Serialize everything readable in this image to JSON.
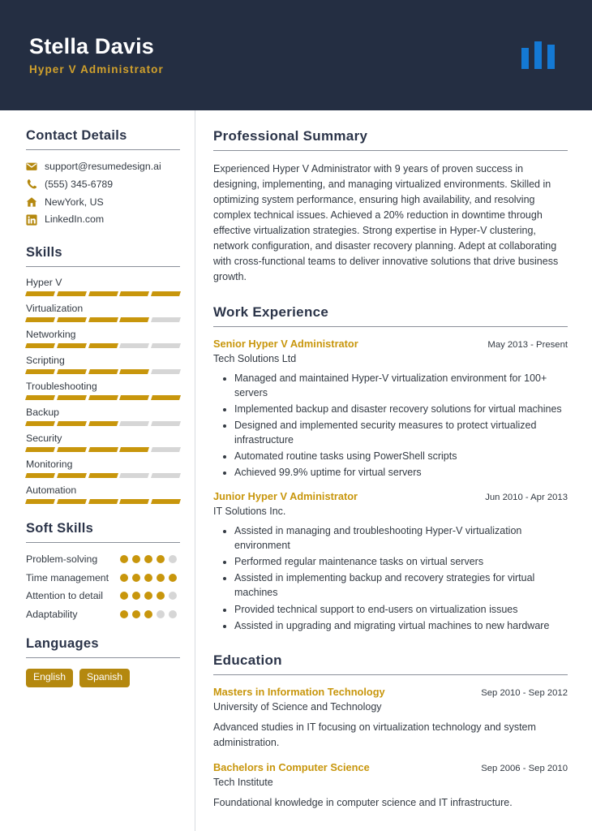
{
  "header": {
    "full_name": "Stella Davis",
    "job_title": "Hyper V Administrator",
    "logo_icon": "three-bars-logo-icon",
    "background_color": "#242e42",
    "accent_color": "#d1a12c",
    "logo_color": "#1479d4"
  },
  "sidebar": {
    "contact": {
      "heading": "Contact Details",
      "items": [
        {
          "icon": "envelope-icon",
          "text": "support@resumedesign.ai"
        },
        {
          "icon": "phone-icon",
          "text": "(555) 345-6789"
        },
        {
          "icon": "home-icon",
          "text": "NewYork, US"
        },
        {
          "icon": "linkedin-icon",
          "text": "LinkedIn.com"
        }
      ]
    },
    "skills": {
      "heading": "Skills",
      "segments_total": 5,
      "items": [
        {
          "name": "Hyper V",
          "filled": 5
        },
        {
          "name": "Virtualization",
          "filled": 4
        },
        {
          "name": "Networking",
          "filled": 3
        },
        {
          "name": "Scripting",
          "filled": 4
        },
        {
          "name": "Troubleshooting",
          "filled": 5
        },
        {
          "name": "Backup",
          "filled": 3
        },
        {
          "name": "Security",
          "filled": 4
        },
        {
          "name": "Monitoring",
          "filled": 3
        },
        {
          "name": "Automation",
          "filled": 5
        }
      ]
    },
    "soft_skills": {
      "heading": "Soft Skills",
      "dots_total": 5,
      "items": [
        {
          "name": "Problem-solving",
          "filled": 4
        },
        {
          "name": "Time management",
          "filled": 5
        },
        {
          "name": "Attention to detail",
          "filled": 4
        },
        {
          "name": "Adaptability",
          "filled": 3
        }
      ]
    },
    "languages": {
      "heading": "Languages",
      "items": [
        "English",
        "Spanish"
      ]
    }
  },
  "main": {
    "summary": {
      "heading": "Professional Summary",
      "text": "Experienced Hyper V Administrator with 9 years of proven success in designing, implementing, and managing virtualized environments. Skilled in optimizing system performance, ensuring high availability, and resolving complex technical issues. Achieved a 20% reduction in downtime through effective virtualization strategies. Strong expertise in Hyper-V clustering, network configuration, and disaster recovery planning. Adept at collaborating with cross-functional teams to deliver innovative solutions that drive business growth."
    },
    "experience": {
      "heading": "Work Experience",
      "entries": [
        {
          "role": "Senior Hyper V Administrator",
          "date": "May 2013 - Present",
          "organization": "Tech Solutions Ltd",
          "bullets": [
            "Managed and maintained Hyper-V virtualization environment for 100+ servers",
            "Implemented backup and disaster recovery solutions for virtual machines",
            "Designed and implemented security measures to protect virtualized infrastructure",
            "Automated routine tasks using PowerShell scripts",
            "Achieved 99.9% uptime for virtual servers"
          ]
        },
        {
          "role": "Junior Hyper V Administrator",
          "date": "Jun 2010 - Apr 2013",
          "organization": "IT Solutions Inc.",
          "bullets": [
            "Assisted in managing and troubleshooting Hyper-V virtualization environment",
            "Performed regular maintenance tasks on virtual servers",
            "Assisted in implementing backup and recovery strategies for virtual machines",
            "Provided technical support to end-users on virtualization issues",
            "Assisted in upgrading and migrating virtual machines to new hardware"
          ]
        }
      ]
    },
    "education": {
      "heading": "Education",
      "entries": [
        {
          "degree": "Masters in Information Technology",
          "date": "Sep 2010 - Sep 2012",
          "institution": "University of Science and Technology",
          "description": "Advanced studies in IT focusing on virtualization technology and system administration."
        },
        {
          "degree": "Bachelors in Computer Science",
          "date": "Sep 2006 - Sep 2010",
          "institution": "Tech Institute",
          "description": "Foundational knowledge in computer science and IT infrastructure."
        }
      ]
    }
  }
}
